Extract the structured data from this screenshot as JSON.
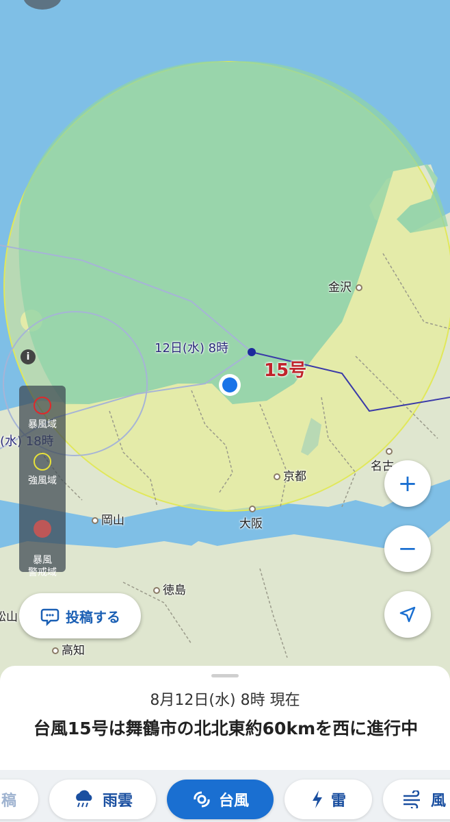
{
  "map": {
    "typhoon_label": "15号",
    "forecast_time_label": "12日(水) 8時",
    "past_time_label": "(水) 18時",
    "cities": [
      {
        "name": "金沢"
      },
      {
        "name": "京都"
      },
      {
        "name": "名古"
      },
      {
        "name": "大阪"
      },
      {
        "name": "岡山"
      },
      {
        "name": "徳島"
      },
      {
        "name": "高知"
      },
      {
        "name": "松山"
      }
    ]
  },
  "legend": {
    "items": [
      {
        "label": "暴風域",
        "color": "#e0282a"
      },
      {
        "label": "強風域",
        "color": "#e8e23a"
      },
      {
        "label": "暴風\n警戒域",
        "color": "#d9534f"
      }
    ]
  },
  "controls": {
    "post_label": "投稿する",
    "zoom_in": "+",
    "zoom_out": "−"
  },
  "sheet": {
    "timestamp": "8月12日(水) 8時 現在",
    "headline": "台風15号は舞鶴市の北北東約60kmを西に進行中"
  },
  "tabs": [
    {
      "label": "稿",
      "icon": "post-icon"
    },
    {
      "label": "雨雲",
      "icon": "rain-cloud-icon"
    },
    {
      "label": "台風",
      "icon": "typhoon-icon",
      "active": true
    },
    {
      "label": "雷",
      "icon": "lightning-icon"
    },
    {
      "label": "風",
      "icon": "wind-icon"
    }
  ],
  "colors": {
    "accent": "#1a6fd1",
    "sea": "#7fbfe6",
    "land": "#dfe6cf",
    "strong_wind_area": "#e8ee8a",
    "warning_area": "#8fd3a8"
  }
}
